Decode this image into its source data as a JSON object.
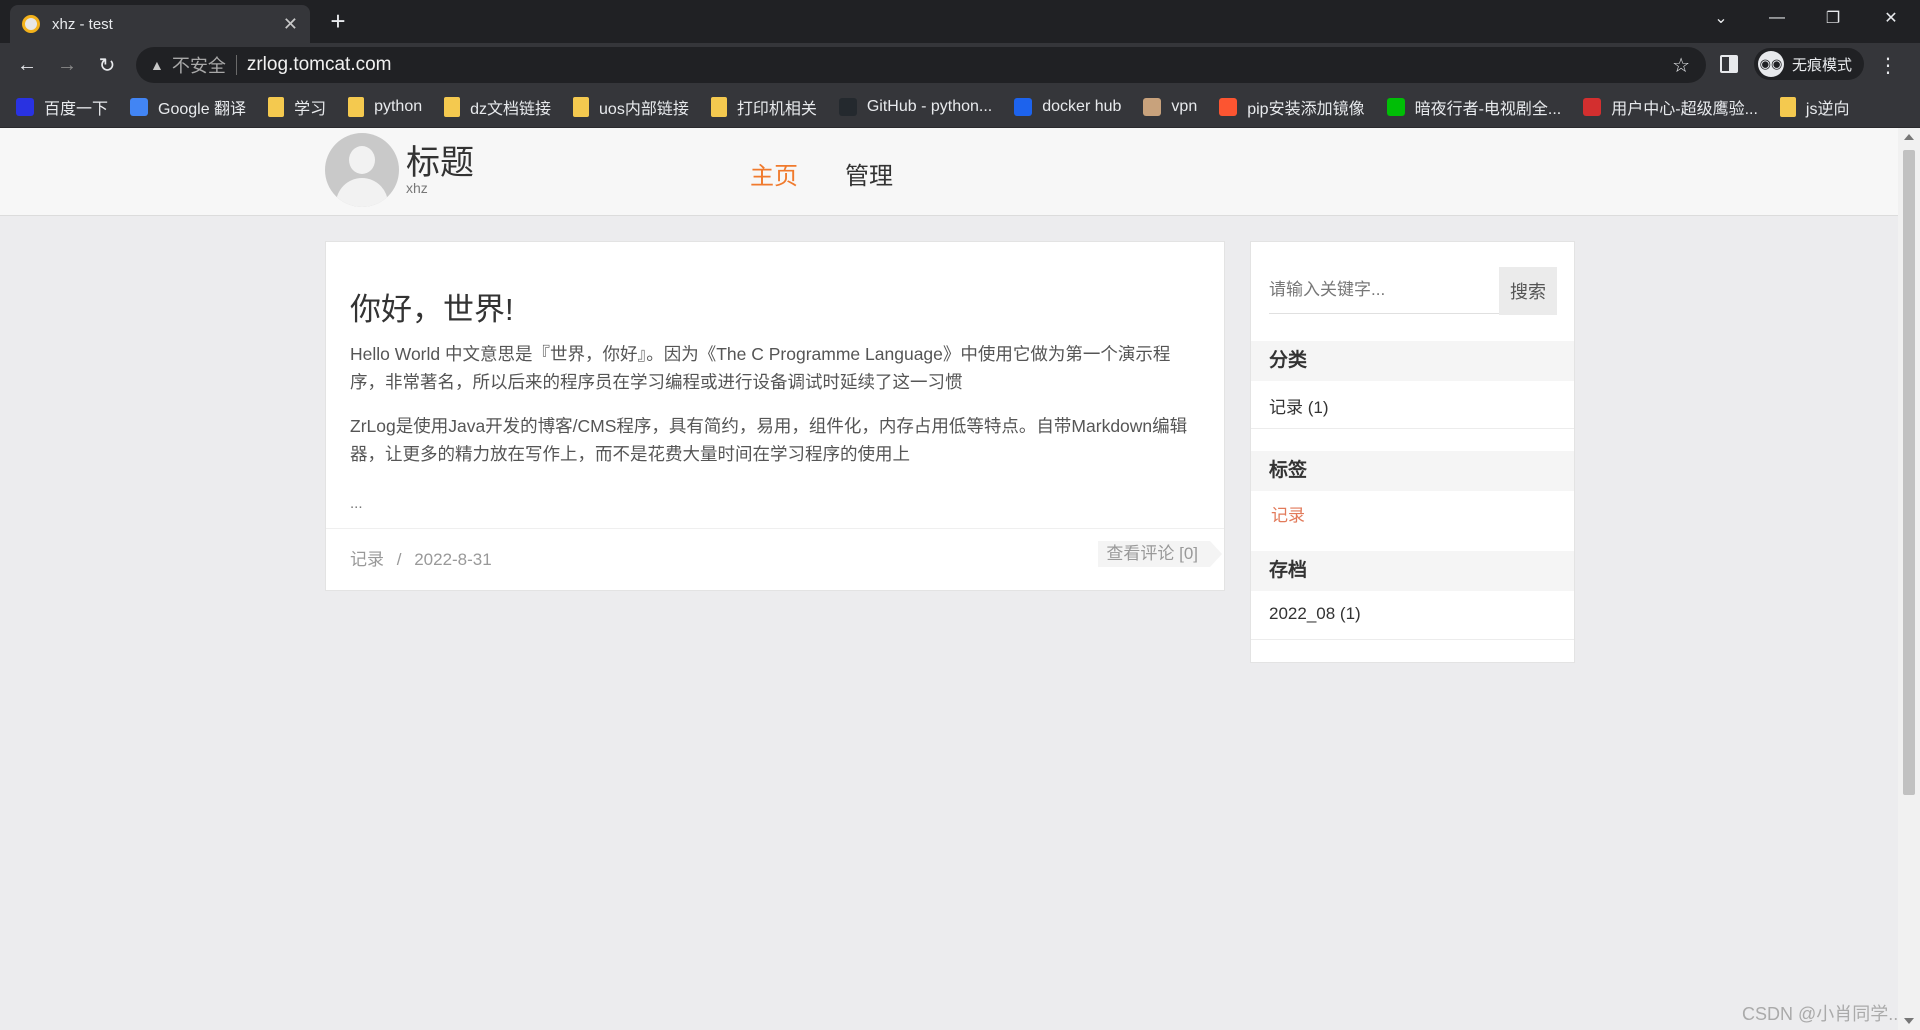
{
  "browser": {
    "tab_title": "xhz - test",
    "tab_close": "✕",
    "new_tab": "+",
    "window_controls": {
      "dropdown": "⌄",
      "minimize": "—",
      "restore": "❐",
      "close": "✕"
    },
    "nav": {
      "back": "←",
      "forward": "→",
      "reload": "↻"
    },
    "security_icon": "▲",
    "security_label": "不安全",
    "url": "zrlog.tomcat.com",
    "bookmark_star": "☆",
    "incognito_label": "无痕模式",
    "menu": "⋮"
  },
  "bookmarks": [
    {
      "label": "百度一下",
      "icon": "baidu-icon",
      "color": "#2932e1"
    },
    {
      "label": "Google 翻译",
      "icon": "google-translate-icon",
      "color": "#4285f4"
    },
    {
      "label": "学习",
      "icon": "folder-icon",
      "color": "#f4c94f"
    },
    {
      "label": "python",
      "icon": "folder-icon",
      "color": "#f4c94f"
    },
    {
      "label": "dz文档链接",
      "icon": "folder-icon",
      "color": "#f4c94f"
    },
    {
      "label": "uos内部链接",
      "icon": "folder-icon",
      "color": "#f4c94f"
    },
    {
      "label": "打印机相关",
      "icon": "folder-icon",
      "color": "#f4c94f"
    },
    {
      "label": "GitHub - python...",
      "icon": "github-icon",
      "color": "#24292e"
    },
    {
      "label": "docker hub",
      "icon": "docker-icon",
      "color": "#1d63ed"
    },
    {
      "label": "vpn",
      "icon": "vpn-icon",
      "color": "#c8a27c"
    },
    {
      "label": "pip安装添加镜像",
      "icon": "csdn-icon",
      "color": "#fc5531"
    },
    {
      "label": "暗夜行者-电视剧全...",
      "icon": "iqiyi-icon",
      "color": "#00be06"
    },
    {
      "label": "用户中心-超级鹰验...",
      "icon": "eagle-icon",
      "color": "#d32f2f"
    },
    {
      "label": "js逆向",
      "icon": "folder-icon",
      "color": "#f4c94f"
    }
  ],
  "site": {
    "title": "标题",
    "subtitle": "xhz",
    "nav": [
      {
        "label": "主页",
        "active": true
      },
      {
        "label": "管理",
        "active": false
      }
    ],
    "accent_color": "#f07a2d"
  },
  "post": {
    "title": "你好，世界!",
    "paragraphs": [
      "Hello World 中文意思是『世界，你好』。因为《The C Programme Language》中使用它做为第一个演示程序，非常著名，所以后来的程序员在学习编程或进行设备调试时延续了这一习惯",
      "ZrLog是使用Java开发的博客/CMS程序，具有简约，易用，组件化，内存占用低等特点。自带Markdown编辑器，让更多的精力放在写作上，而不是花费大量时间在学习程序的使用上"
    ],
    "ellipsis": "...",
    "category": "记录",
    "separator": "/",
    "date": "2022-8-31",
    "comments_label": "查看评论 [0]"
  },
  "sidebar": {
    "search_placeholder": "请输入关键字...",
    "search_button": "搜索",
    "categories_heading": "分类",
    "categories": [
      "记录 (1)"
    ],
    "tags_heading": "标签",
    "tags": [
      "记录"
    ],
    "archives_heading": "存档",
    "archives": [
      "2022_08 (1)"
    ]
  },
  "watermark": "CSDN @小肖同学.."
}
